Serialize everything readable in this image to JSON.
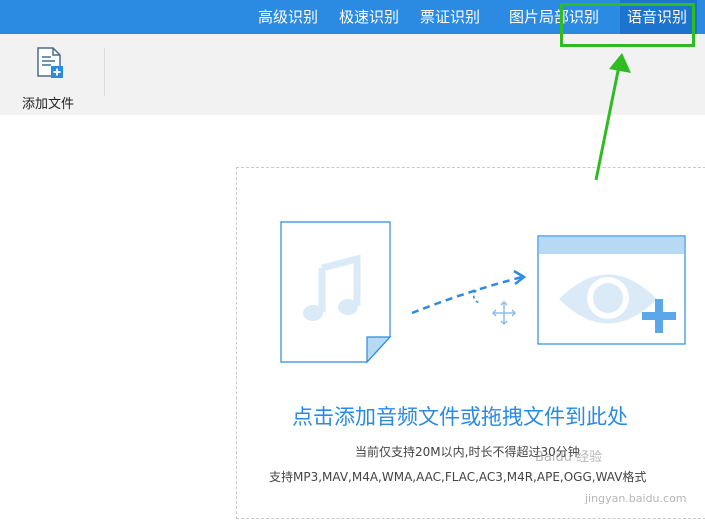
{
  "tabs": [
    {
      "label": "高级识别",
      "active": false
    },
    {
      "label": "极速识别",
      "active": false
    },
    {
      "label": "票证识别",
      "active": false
    },
    {
      "label": "图片局部识别",
      "active": false
    },
    {
      "label": "语音识别",
      "active": true
    }
  ],
  "toolbar": {
    "add_file_label": "添加文件",
    "add_file_icon": "add-file-icon"
  },
  "dropzone": {
    "main_text": "点击添加音频文件或拖拽文件到此处",
    "limit_text": "当前仅支持20M以内,时长不得超过30分钟",
    "formats_text": "支持MP3,MAV,M4A,WMA,AAC,FLAC,AC3,M4R,APE,OGG,WAV格式"
  },
  "watermark": {
    "text": "Baidu 经验",
    "url_text": "jingyan.baidu.com"
  },
  "colors": {
    "accent": "#2b8ae2",
    "active_tab": "#1c74cf",
    "highlight": "#2fbb22",
    "toolbar_bg": "#f2f2f2",
    "icon_light_blue": "#b7d9f4"
  }
}
